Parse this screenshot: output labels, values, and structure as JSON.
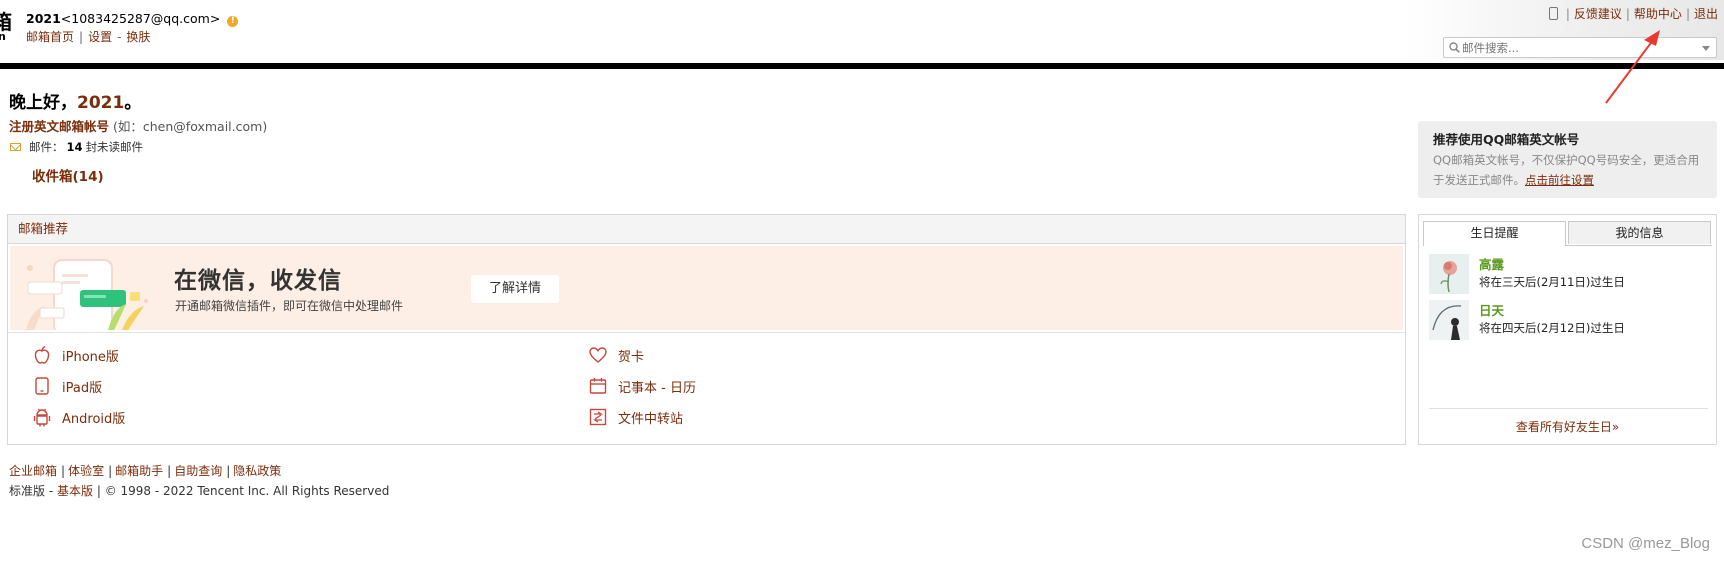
{
  "header": {
    "logo_glyph_top": "箱",
    "logo_glyph_bottom": "n",
    "username": "2021",
    "email_display": "<1083425287@qq.com>",
    "warning_mark": "!",
    "nav": {
      "home": "邮箱首页",
      "sep1": "|",
      "settings": "设置",
      "sep2": "-",
      "skin": "换肤"
    },
    "top_links": {
      "sep1": "|",
      "feedback": "反馈建议",
      "sep2": "|",
      "help": "帮助中心",
      "sep3": "|",
      "logout": "退出"
    },
    "search": {
      "placeholder": "邮件搜索..."
    }
  },
  "greeting": {
    "prefix": "晚上好，",
    "name": "2021",
    "suffix": "。",
    "register_link": "注册英文邮箱帐号",
    "register_hint": "(如：chen@foxmail.com)",
    "mail_label": "邮件：",
    "unread_count": "14",
    "unread_suffix": "封未读邮件",
    "inbox_label": "收件箱(14)"
  },
  "promo": {
    "title": "推荐使用QQ邮箱英文帐号",
    "desc": "QQ邮箱英文帐号，不仅保护QQ号码安全，更适合用于发送正式邮件。",
    "link": "点击前往设置"
  },
  "recommend": {
    "title": "邮箱推荐",
    "banner_title": "在微信，收发信",
    "banner_desc": "开通邮箱微信插件，即可在微信中处理邮件",
    "banner_button": "了解详情",
    "apps": {
      "iphone": "iPhone版",
      "ipad": "iPad版",
      "android": "Android版",
      "card": "贺卡",
      "notebook": "记事本 - 日历",
      "transfer": "文件中转站"
    }
  },
  "birthday": {
    "tabs": [
      "生日提醒",
      "我的信息"
    ],
    "friends": [
      {
        "name": "高露",
        "desc": "将在三天后(2月11日)过生日"
      },
      {
        "name": "日天",
        "desc": "将在四天后(2月12日)过生日"
      }
    ],
    "view_all": "查看所有好友生日»"
  },
  "footer": {
    "links": [
      "企业邮箱",
      "体验室",
      "邮箱助手",
      "自助查询",
      "隐私政策"
    ],
    "sep": "|",
    "edition_standard": "标准版",
    "edition_dash": "-",
    "edition_basic": "基本版",
    "copyright": " | © 1998 - 2022 Tencent Inc. All Rights Reserved"
  },
  "watermark": "CSDN @mez_Blog",
  "colors": {
    "link": "#7b2d0b",
    "banner_bg": "#fdeee6",
    "friend_name": "#5a9a1e",
    "annotation_arrow": "#e83a2e"
  }
}
